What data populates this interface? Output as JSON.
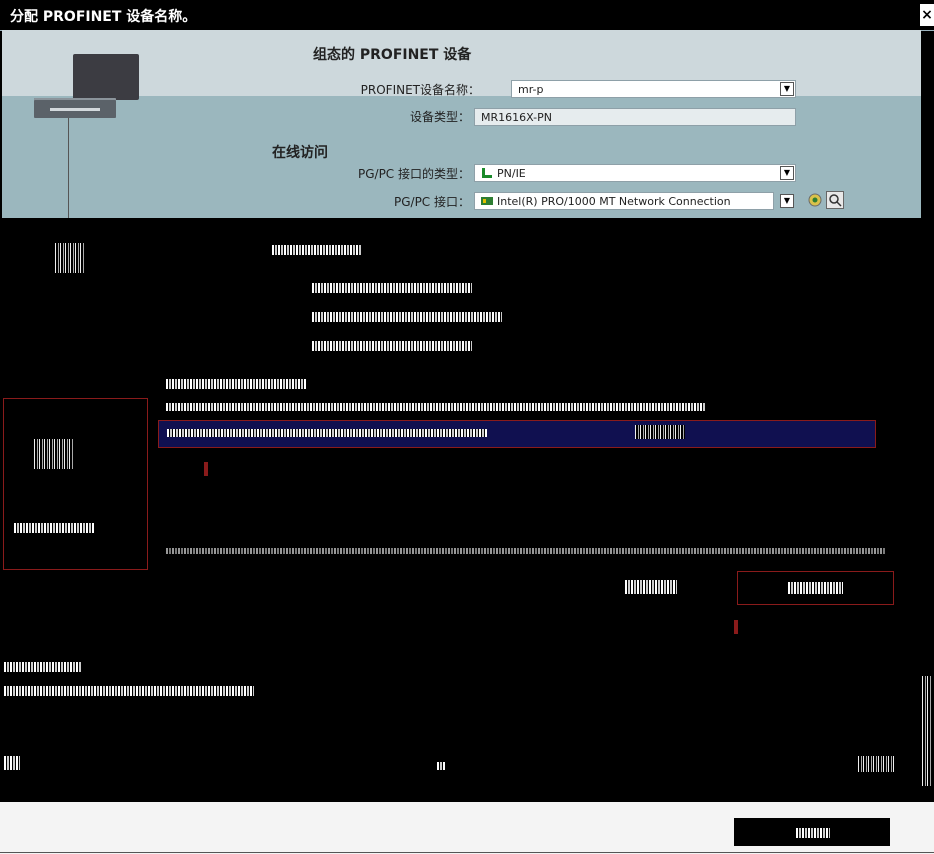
{
  "window": {
    "title": "分配 PROFINET 设备名称。",
    "close_label": "×"
  },
  "configured": {
    "heading": "组态的 PROFINET 设备",
    "name_label": "PROFINET设备名称：",
    "name_value": "mr-p",
    "type_label": "设备类型：",
    "type_value": "MR1616X-PN"
  },
  "online": {
    "heading": "在线访问",
    "iface_type_label": "PG/PC 接口的类型：",
    "iface_type_value": "PN/IE",
    "iface_label": "PG/PC 接口：",
    "iface_value": "Intel(R) PRO/1000 MT Network Connection"
  },
  "icons": {
    "pc": "pc-station-icon",
    "dropdown": "chevron-down-icon",
    "network": "network-icon",
    "refresh": "refresh-icon",
    "search": "search-icon",
    "close": "close-icon"
  },
  "colors": {
    "panel": "#cdd8dc",
    "panel_dark": "#9bb7be",
    "highlight_box": "#8a1b1b",
    "selected_row": "#101050"
  }
}
